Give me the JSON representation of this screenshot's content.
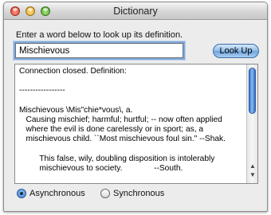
{
  "window": {
    "title": "Dictionary"
  },
  "prompt_label": "Enter a word below to look up its definition.",
  "search": {
    "value": "Mischievous",
    "button_label": "Look Up"
  },
  "result": {
    "text": "Connection closed. Definition:\n\n-----------------\n\nMischievous \\Mis\"chie*vous\\, a.\n   Causing mischief; harmful; hurtful; -- now often applied\n   where the evil is done carelessly or in sport; as, a\n   mischievous child. ``Most mischievous foul sin.\" --Shak.\n\n         This false, wily, doubling disposition is intolerably\n         mischievous to society.              --South.\n\n   Syn: Harmful; hurtful; detrimental; noxious; pernicious;"
  },
  "mode": {
    "async_label": "Asynchronous",
    "sync_label": "Synchronous",
    "selected": "Asynchronous"
  },
  "colors": {
    "accent": "#3c7fd0",
    "window_bg": "#ececec"
  },
  "icons": {
    "close": "close-icon",
    "minimize": "minimize-icon",
    "zoom": "zoom-icon"
  }
}
